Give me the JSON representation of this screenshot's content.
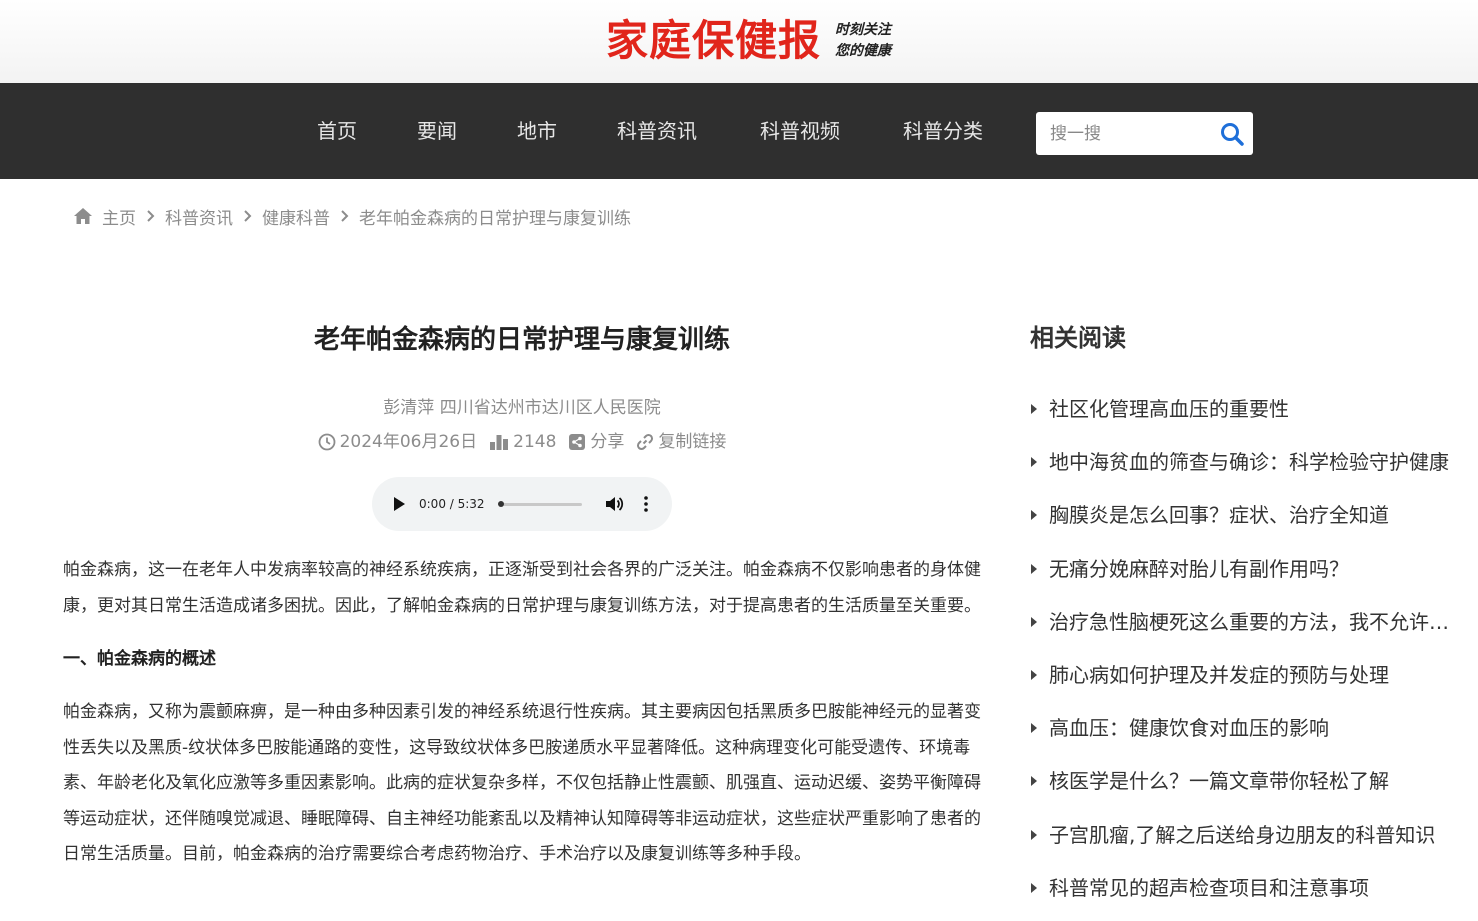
{
  "header": {
    "logo_text": "家庭保健报",
    "slogan_line1": "时刻关注",
    "slogan_line2": "您的健康"
  },
  "nav": {
    "items": [
      {
        "label": "首页"
      },
      {
        "label": "要闻"
      },
      {
        "label": "地市"
      },
      {
        "label": "科普资讯"
      },
      {
        "label": "科普视频"
      },
      {
        "label": "科普分类"
      }
    ],
    "search_placeholder": "搜一搜",
    "search_value": ""
  },
  "breadcrumb": {
    "items": [
      "主页",
      "科普资讯",
      "健康科普",
      "老年帕金森病的日常护理与康复训练"
    ]
  },
  "article": {
    "title": "老年帕金森病的日常护理与康复训练",
    "author": "彭清萍  四川省达州市达川区人民医院",
    "date": "2024年06月26日",
    "views": "2148",
    "share_label": "分享",
    "copy_link_label": "复制链接",
    "audio": {
      "time": "0:00 / 5:32",
      "progress": 0
    },
    "paragraph1": "帕金森病，这一在老年人中发病率较高的神经系统疾病，正逐渐受到社会各界的广泛关注。帕金森病不仅影响患者的身体健康，更对其日常生活造成诸多困扰。因此，了解帕金森病的日常护理与康复训练方法，对于提高患者的生活质量至关重要。",
    "section1_heading": "一、帕金森病的概述",
    "paragraph2": "帕金森病，又称为震颤麻痹，是一种由多种因素引发的神经系统退行性疾病。其主要病因包括黑质多巴胺能神经元的显著变性丢失以及黑质-纹状体多巴胺能通路的变性，这导致纹状体多巴胺递质水平显著降低。这种病理变化可能受遗传、环境毒素、年龄老化及氧化应激等多重因素影响。此病的症状复杂多样，不仅包括静止性震颤、肌强直、运动迟缓、姿势平衡障碍等运动症状，还伴随嗅觉减退、睡眠障碍、自主神经功能紊乱以及精神认知障碍等非运动症状，这些症状严重影响了患者的日常生活质量。目前，帕金森病的治疗需要综合考虑药物治疗、手术治疗以及康复训练等多种手段。"
  },
  "sidebar": {
    "title": "相关阅读",
    "items": [
      "社区化管理高血压的重要性",
      "地中海贫血的筛查与确诊：科学检验守护健康",
      "胸膜炎是怎么回事？症状、治疗全知道",
      "无痛分娩麻醉对胎儿有副作用吗？",
      "治疗急性脑梗死这么重要的方法，我不允许你不知道",
      "肺心病如何护理及并发症的预防与处理",
      "高血压：健康饮食对血压的影响",
      "核医学是什么？一篇文章带你轻松了解",
      "子宫肌瘤,了解之后送给身边朋友的科普知识",
      "科普常见的超声检查项目和注意事项"
    ]
  },
  "colors": {
    "brand_red": "#e1251b",
    "nav_bg": "#2f2f2f",
    "search_icon": "#1e6fd9"
  }
}
